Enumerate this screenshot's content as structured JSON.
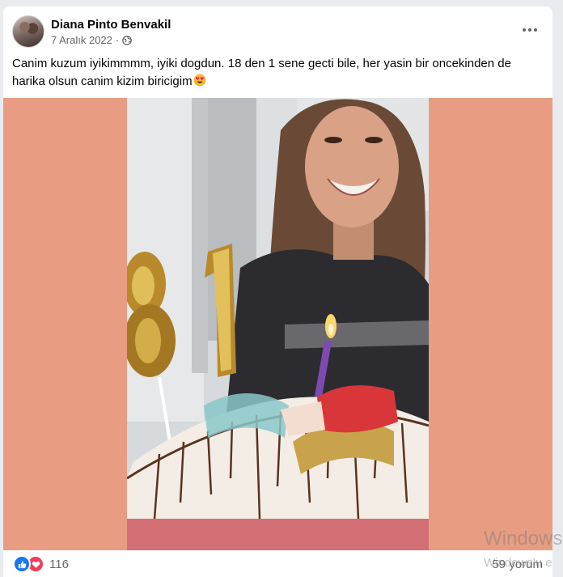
{
  "post": {
    "author": "Diana Pinto Benvakil",
    "date": "7 Aralık 2022",
    "separator": "·",
    "visibility_icon": "globe-icon",
    "caption": "Canim kuzum iyikimmmm, iyiki dogdun. 18 den 1 sene gecti bile, her yasin bir oncekinden de harika olsun canim kizim biricigim",
    "caption_emoji": "heart-eyes-emoji",
    "more_icon": "more-dots-icon"
  },
  "photo": {
    "background_color": "#e89d82"
  },
  "footer": {
    "reaction_icons": [
      "like-icon",
      "love-icon"
    ],
    "reaction_count": "116",
    "comments": "59 yorum"
  },
  "watermark": {
    "line1": "Windows",
    "line2": "Windows'u e"
  },
  "colors": {
    "like": "#1877f2",
    "love": "#f33e58",
    "secondary_text": "#65676b"
  }
}
